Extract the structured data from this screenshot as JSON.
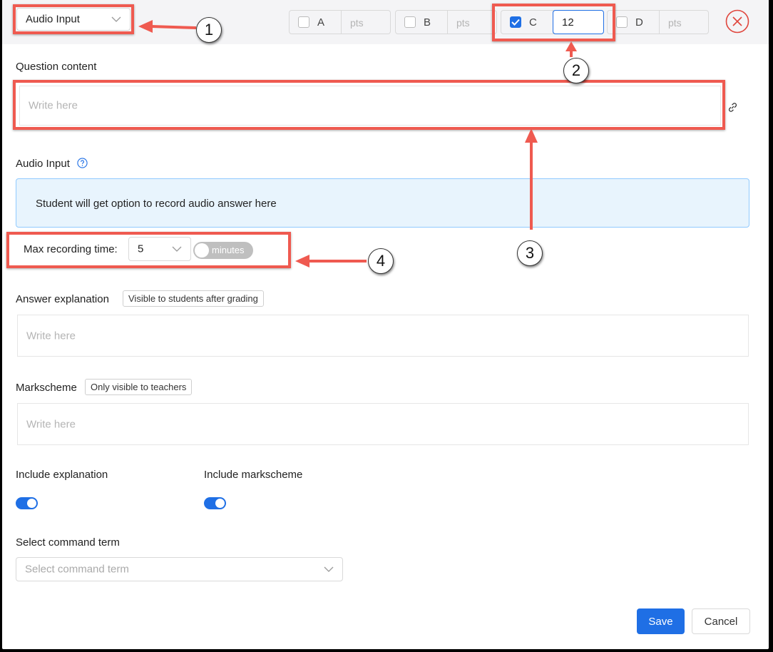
{
  "header": {
    "question_type": "Audio Input",
    "options": [
      {
        "letter": "A",
        "checked": false,
        "points_placeholder": "pts"
      },
      {
        "letter": "B",
        "checked": false,
        "points_placeholder": "pts"
      },
      {
        "letter": "C",
        "checked": true,
        "points_value": "12"
      },
      {
        "letter": "D",
        "checked": false,
        "points_placeholder": "pts"
      }
    ]
  },
  "question_content": {
    "label": "Question content",
    "placeholder": "Write here"
  },
  "audio_input": {
    "label": "Audio Input",
    "info_text": "Student will get option to record audio answer here",
    "max_time_label": "Max recording time:",
    "max_time_value": "5",
    "unit_toggle_label": "minutes"
  },
  "answer_explanation": {
    "label": "Answer explanation",
    "tag": "Visible to students after grading",
    "placeholder": "Write here"
  },
  "markscheme": {
    "label": "Markscheme",
    "tag": "Only visible to teachers",
    "placeholder": "Write here"
  },
  "include_explanation": {
    "label": "Include explanation",
    "enabled": true
  },
  "include_markscheme": {
    "label": "Include markscheme",
    "enabled": true
  },
  "command_term": {
    "label": "Select command term",
    "placeholder": "Select command term"
  },
  "footer": {
    "save_label": "Save",
    "cancel_label": "Cancel"
  },
  "annotations": [
    "1",
    "2",
    "3",
    "4"
  ],
  "colors": {
    "accent": "#1f6fe5",
    "annotation": "#ef5a50",
    "close": "#e0463d",
    "info_bg": "#e8f4fd"
  }
}
